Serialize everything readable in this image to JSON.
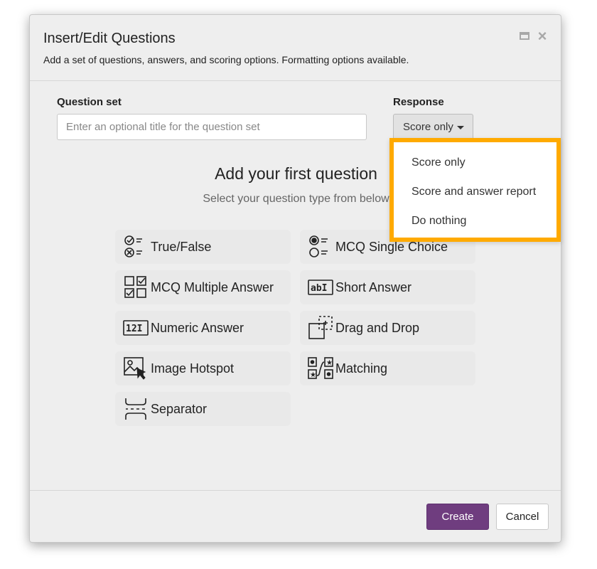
{
  "dialog": {
    "title": "Insert/Edit Questions",
    "subtitle": "Add a set of questions, answers, and scoring options. Formatting options available.",
    "maximize_icon": "maximize-icon",
    "close_icon": "close-icon",
    "close_glyph": "×"
  },
  "question_set": {
    "label": "Question set",
    "placeholder": "Enter an optional title for the question set",
    "value": ""
  },
  "response": {
    "label": "Response",
    "selected": "Score only",
    "options": [
      "Score only",
      "Score and answer report",
      "Do nothing"
    ]
  },
  "main": {
    "heading": "Add your first question",
    "subheading": "Select your question type from below",
    "question_types": [
      {
        "label": "True/False",
        "icon": "true-false-icon"
      },
      {
        "label": "MCQ Single Choice",
        "icon": "mcq-single-choice-icon"
      },
      {
        "label": "MCQ Multiple Answer",
        "icon": "mcq-multiple-answer-icon"
      },
      {
        "label": "Short Answer",
        "icon": "short-answer-icon"
      },
      {
        "label": "Numeric Answer",
        "icon": "numeric-answer-icon"
      },
      {
        "label": "Drag and Drop",
        "icon": "drag-and-drop-icon"
      },
      {
        "label": "Image Hotspot",
        "icon": "image-hotspot-icon"
      },
      {
        "label": "Matching",
        "icon": "matching-icon"
      },
      {
        "label": "Separator",
        "icon": "separator-icon"
      }
    ]
  },
  "footer": {
    "create_label": "Create",
    "cancel_label": "Cancel"
  },
  "colors": {
    "accent": "#6f3d7f",
    "highlight": "#ffaa00",
    "dialog_bg": "#eeeeee"
  }
}
